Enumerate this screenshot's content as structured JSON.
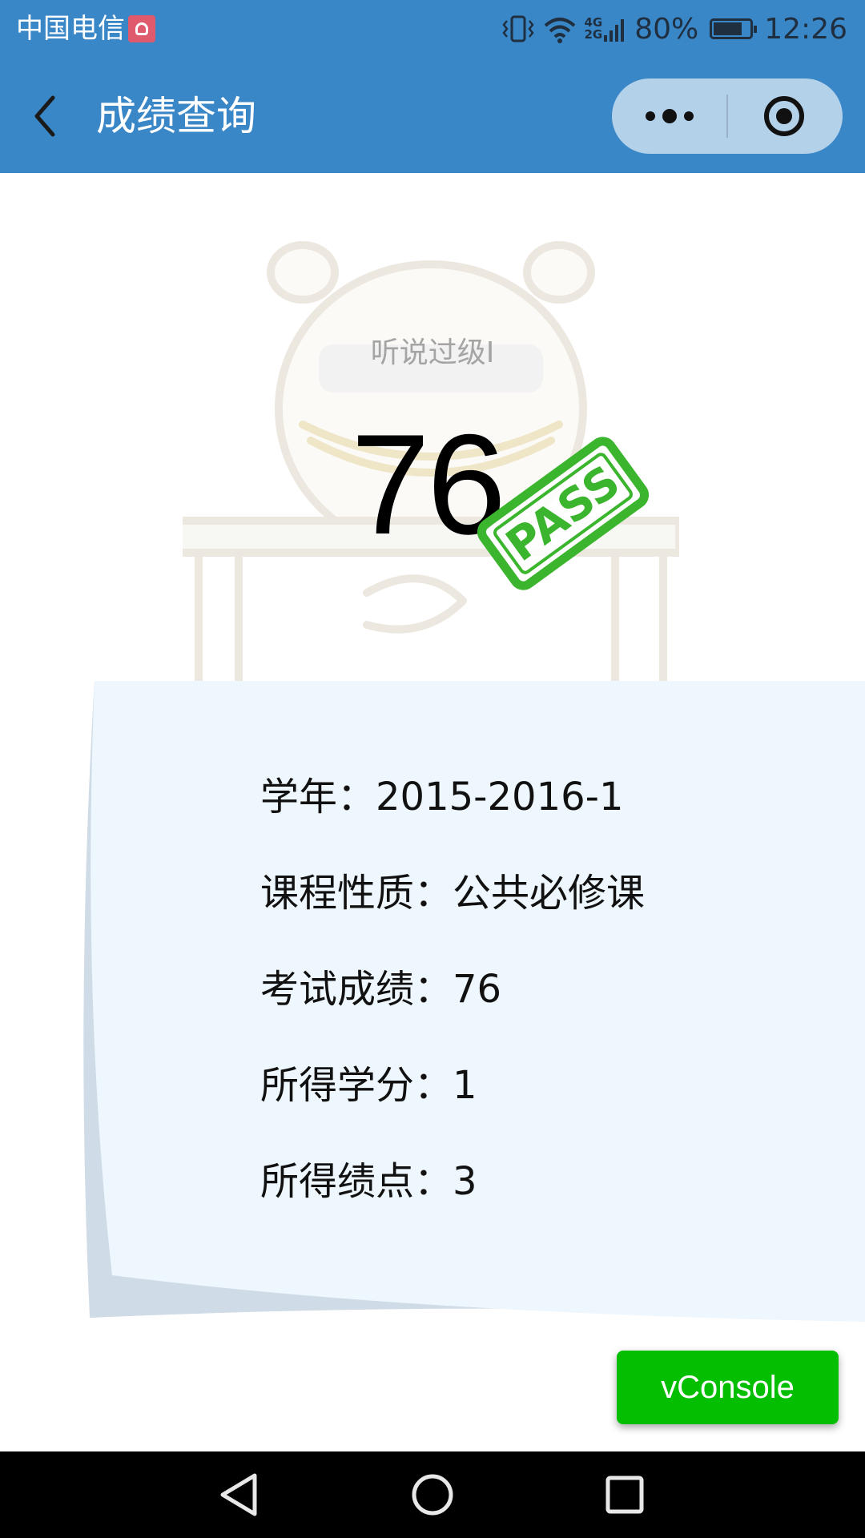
{
  "status_bar": {
    "carrier": "中国电信",
    "network_top": "4G",
    "network_bottom": "2G",
    "battery_percent": "80%",
    "battery_level": 0.8,
    "time": "12:26"
  },
  "title_bar": {
    "title": "成绩查询",
    "background_color": "#3a87c8"
  },
  "result": {
    "course_name": "听说过级Ⅰ",
    "score": "76",
    "stamp_text": "PASS",
    "stamp_color": "#3bb52d"
  },
  "details": [
    {
      "label": "学年：",
      "value": "2015-2016-1"
    },
    {
      "label": "课程性质：",
      "value": "公共必修课"
    },
    {
      "label": "考试成绩：",
      "value": "76"
    },
    {
      "label": "所得学分：",
      "value": "1"
    },
    {
      "label": "所得绩点：",
      "value": "3"
    }
  ],
  "vconsole": {
    "label": "vConsole",
    "color": "#04be02"
  },
  "icons": {
    "back": "chevron-left-icon",
    "more": "more-dots-icon",
    "close": "target-circle-icon",
    "nav_back": "triangle-back-icon",
    "nav_home": "circle-home-icon",
    "nav_recent": "square-recent-icon"
  }
}
